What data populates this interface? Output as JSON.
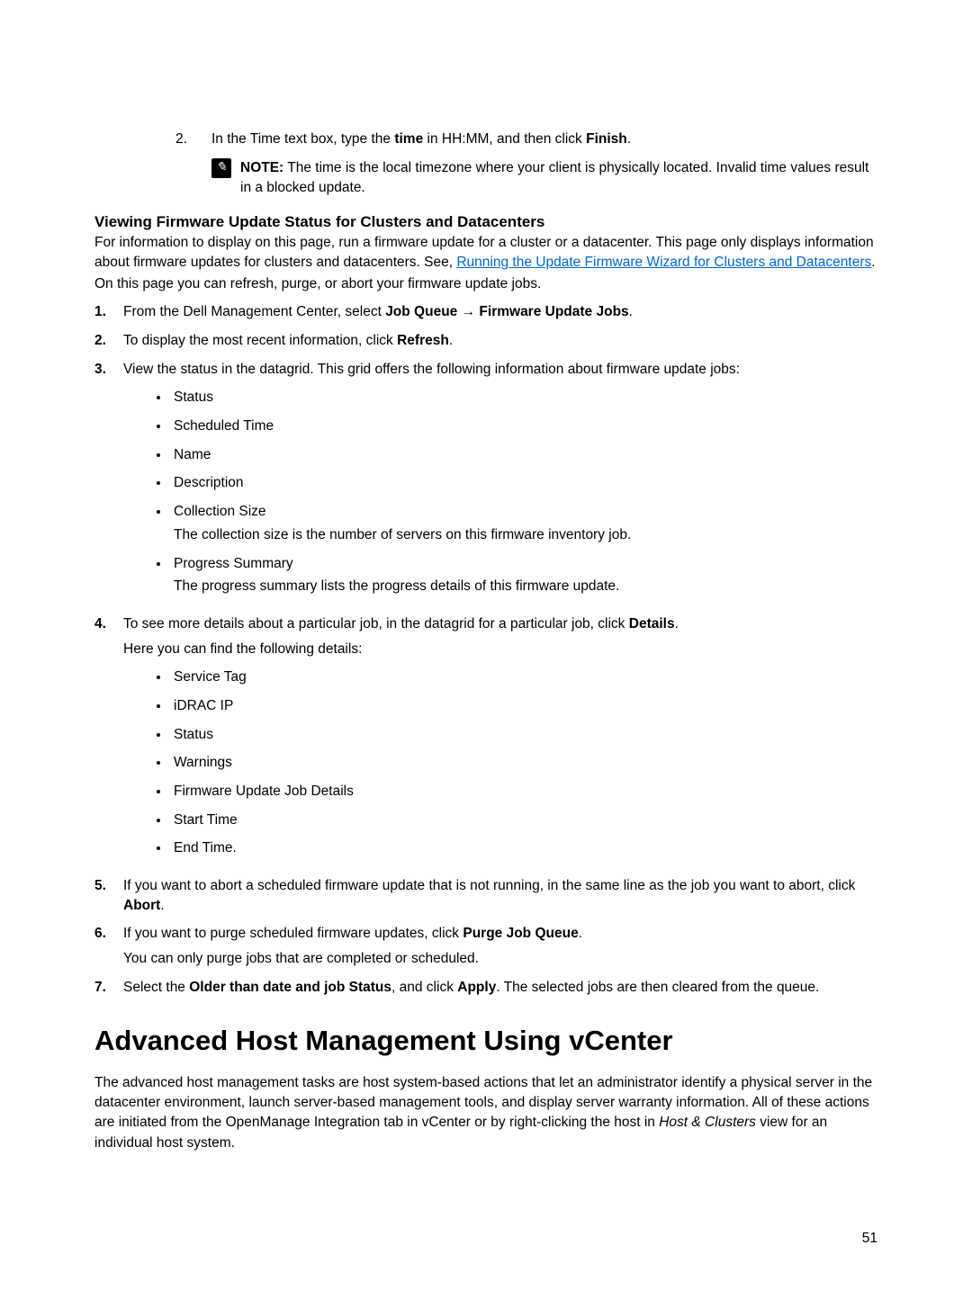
{
  "step2": {
    "num": "2.",
    "text_pre": "In the Time text box, type the ",
    "text_bold1": "time",
    "text_mid": " in HH:MM, and then click ",
    "text_bold2": "Finish",
    "text_end": "."
  },
  "note": {
    "label": "NOTE:",
    "text": " The time is the local timezone where your client is physically located. Invalid time values result in a blocked update."
  },
  "subheading": "Viewing Firmware Update Status for Clusters and Datacenters",
  "intro": {
    "p1_pre": "For information to display on this page, run a firmware update for a cluster or a datacenter. This page only displays information about firmware updates for clusters and datacenters. See, ",
    "p1_link": "Running the Update Firmware Wizard for Clusters and Datacenters",
    "p1_end": ".",
    "p2": "On this page you can refresh, purge, or abort your firmware update jobs."
  },
  "list": {
    "i1": {
      "m": "1.",
      "pre": "From the Dell Management Center, select ",
      "b1": "Job Queue",
      "arrow": " → ",
      "b2": "Firmware Update Jobs",
      "end": "."
    },
    "i2": {
      "m": "2.",
      "pre": "To display the most recent information, click ",
      "b1": "Refresh",
      "end": "."
    },
    "i3": {
      "m": "3.",
      "text": "View the status in the datagrid. This grid offers the following information about firmware update jobs:"
    },
    "i3_bullets": {
      "b1": "Status",
      "b2": "Scheduled Time",
      "b3": "Name",
      "b4": "Description",
      "b5": "Collection Size",
      "b5_desc": "The collection size is the number of servers on this firmware inventory job.",
      "b6": "Progress Summary",
      "b6_desc": "The progress summary lists the progress details of this firmware update."
    },
    "i4": {
      "m": "4.",
      "pre": "To see more details about a particular job, in the datagrid for a particular job, click ",
      "b1": "Details",
      "end": ".",
      "after": "Here you can find the following details:"
    },
    "i4_bullets": {
      "b1": "Service Tag",
      "b2": "iDRAC IP",
      "b3": "Status",
      "b4": "Warnings",
      "b5": "Firmware Update Job Details",
      "b6": "Start Time",
      "b7": "End Time."
    },
    "i5": {
      "m": "5.",
      "pre": "If you want to abort a scheduled firmware update that is not running, in the same line as the job you want to abort, click ",
      "b1": "Abort",
      "end": "."
    },
    "i6": {
      "m": "6.",
      "pre": "If you want to purge scheduled firmware updates, click ",
      "b1": "Purge Job Queue",
      "end": ".",
      "after": "You can only purge jobs that are completed or scheduled."
    },
    "i7": {
      "m": "7.",
      "pre": "Select the ",
      "b1": "Older than date and job Status",
      "mid": ", and click ",
      "b2": "Apply",
      "end": ". The selected jobs are then cleared from the queue."
    }
  },
  "h2": "Advanced Host Management Using vCenter",
  "para": {
    "pre": "The advanced host management tasks are host system-based actions that let an administrator identify a physical server in the datacenter environment, launch server-based management tools, and display server warranty information. All of these actions are initiated from the OpenManage Integration tab in vCenter or by right-clicking the host in ",
    "it": "Host & Clusters",
    "end": " view for an individual host system."
  },
  "pagenum": "51"
}
